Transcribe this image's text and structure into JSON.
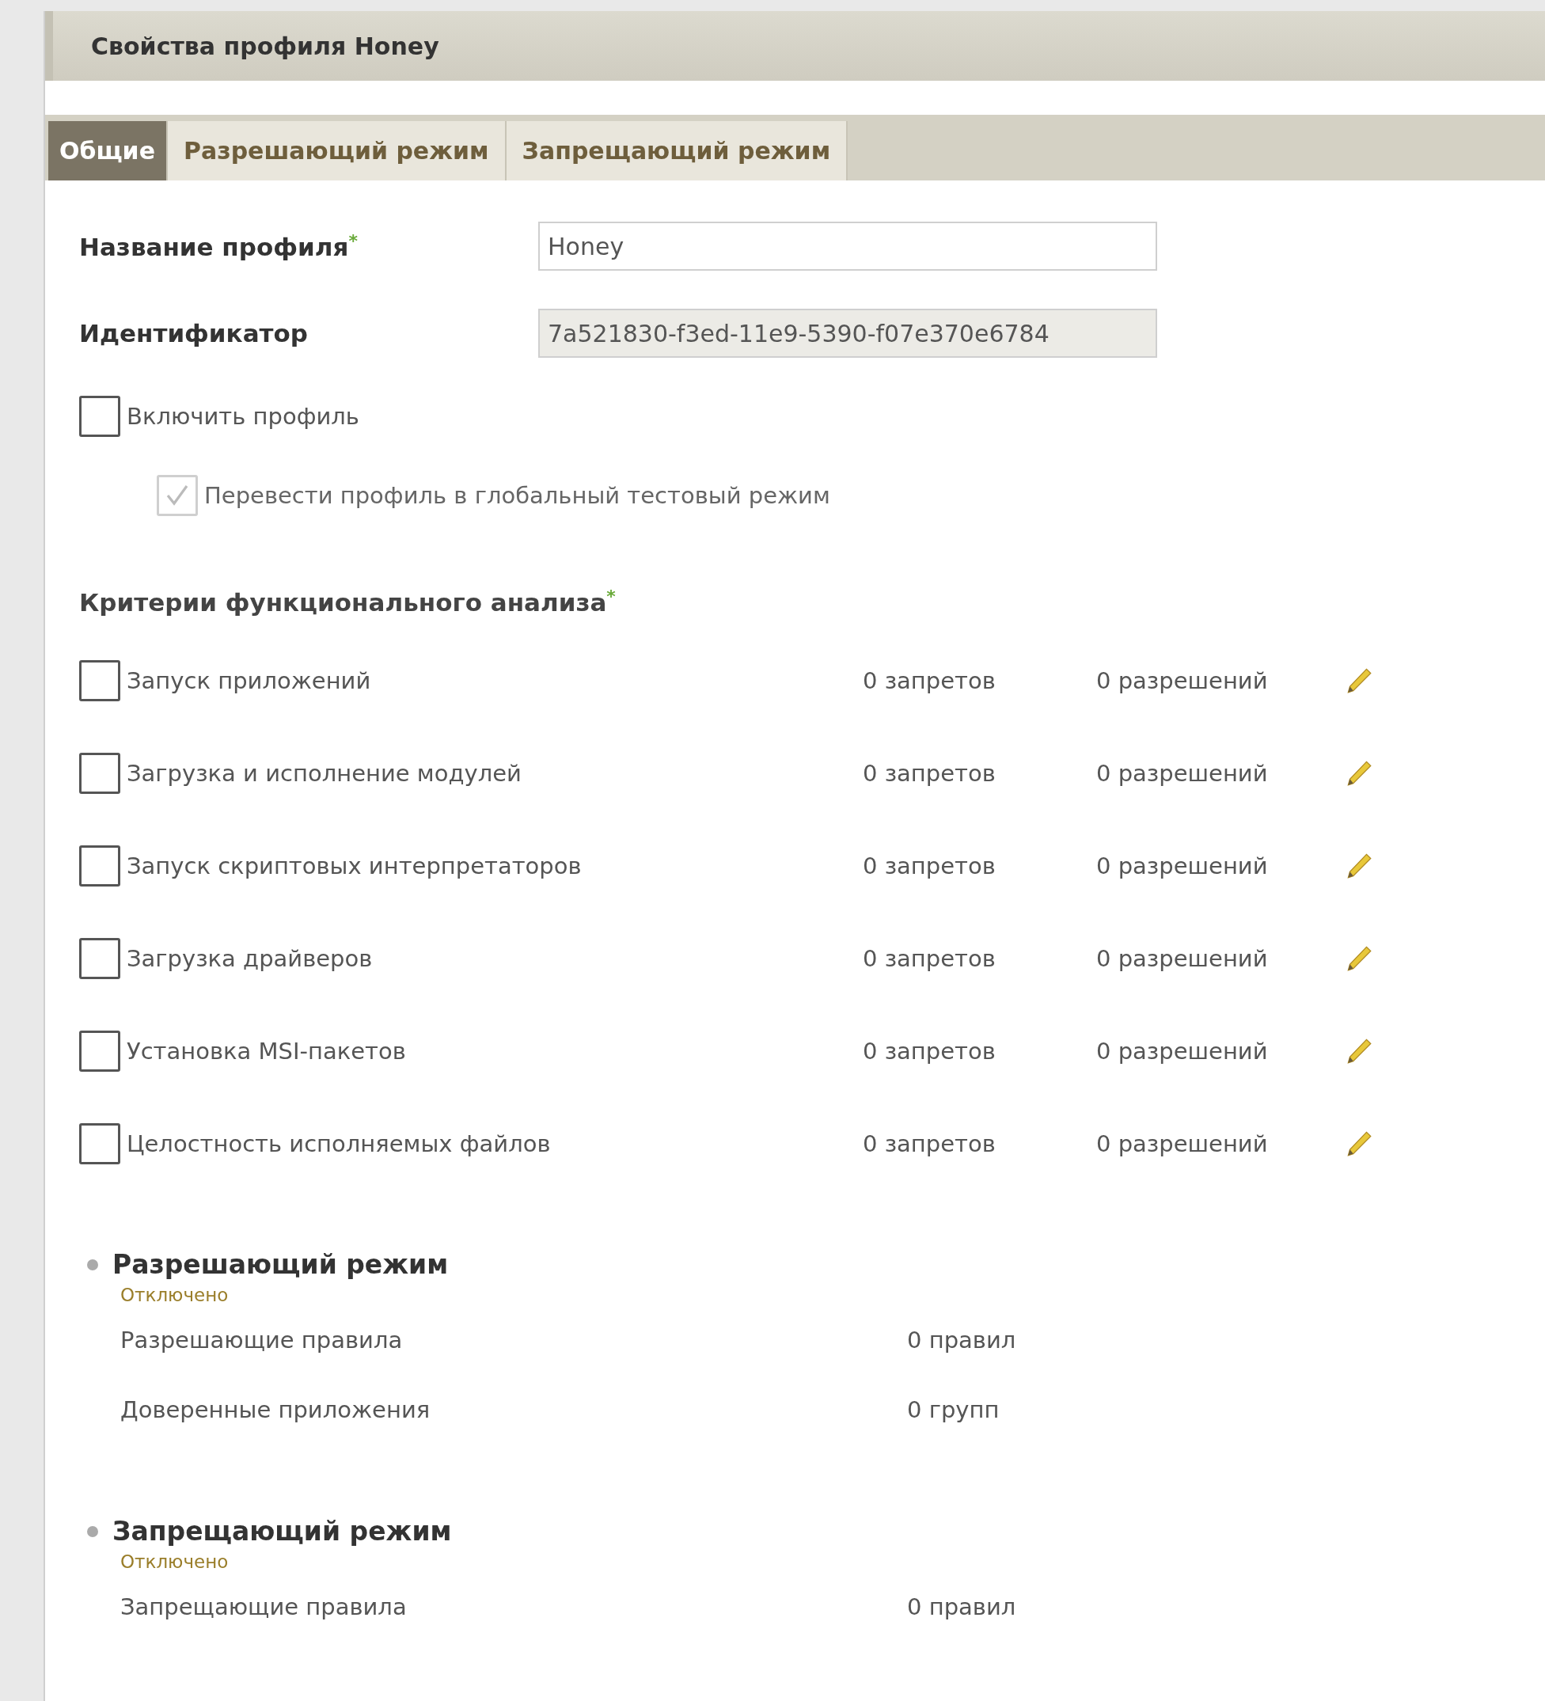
{
  "window": {
    "title": "Свойства профиля Honey"
  },
  "tabs": [
    {
      "label": "Общие",
      "selected": true
    },
    {
      "label": "Разрешающий режим",
      "selected": false
    },
    {
      "label": "Запрещающий режим",
      "selected": false
    }
  ],
  "fields": [
    {
      "label": "Название профиля",
      "required_mark": "*",
      "value": "Honey",
      "disabled": false
    },
    {
      "label": "Идентификатор",
      "value": "7a521830-f3ed-11e9-5390-f07e370e6784",
      "disabled": true
    }
  ],
  "options": [
    {
      "label": "Включить профиль",
      "checked": false,
      "disabled": false,
      "children": [
        {
          "label": "Перевести профиль в глобальный тестовый режим",
          "checked": true,
          "disabled": true
        }
      ]
    }
  ],
  "criteria": {
    "title": "Критерии функционального анализа",
    "required_mark": "*",
    "items": [
      {
        "label": "Запуск приложений",
        "checked": false,
        "denies": "0 запретов",
        "allows": "0 разрешений"
      },
      {
        "label": "Загрузка и исполнение модулей",
        "checked": false,
        "denies": "0 запретов",
        "allows": "0 разрешений"
      },
      {
        "label": "Запуск скриптовых интерпретаторов",
        "checked": false,
        "denies": "0 запретов",
        "allows": "0 разрешений"
      },
      {
        "label": "Загрузка драйверов",
        "checked": false,
        "denies": "0 запретов",
        "allows": "0 разрешений"
      },
      {
        "label": "Установка MSI-пакетов",
        "checked": false,
        "denies": "0 запретов",
        "allows": "0 разрешений"
      },
      {
        "label": "Целостность исполняемых файлов",
        "checked": false,
        "denies": "0 запретов",
        "allows": "0 разрешений"
      }
    ]
  },
  "modes": [
    {
      "title": "Разрешающий режим",
      "status": "Отключено",
      "rows": [
        {
          "label": "Разрешающие правила",
          "value": "0 правил"
        },
        {
          "label": "Доверенные приложения",
          "value": "0 групп"
        }
      ]
    },
    {
      "title": "Запрещающий режим",
      "status": "Отключено",
      "rows": [
        {
          "label": "Запрещающие правила",
          "value": "0 правил"
        }
      ]
    }
  ]
}
